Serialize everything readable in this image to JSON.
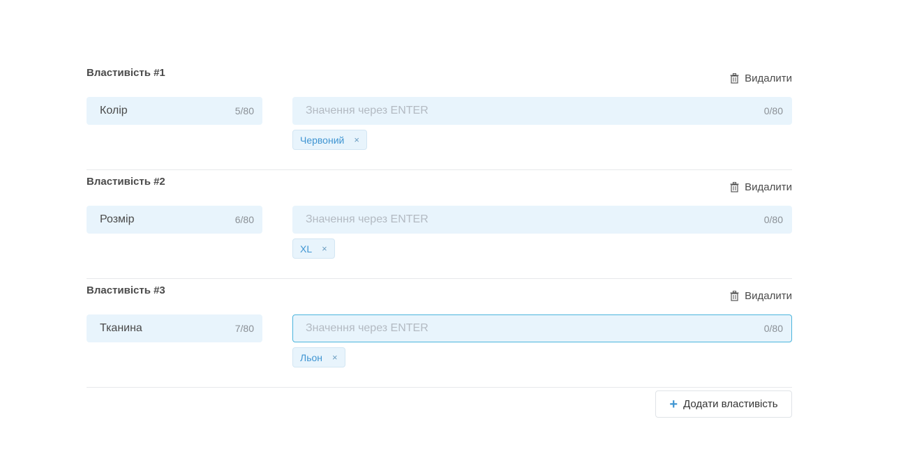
{
  "properties": [
    {
      "title": "Властивість #1",
      "delete_label": "Видалити",
      "name_value": "Колір",
      "name_counter": "5/80",
      "value_placeholder": "Значення через ENTER",
      "value_counter": "0/80",
      "tag": "Червоний"
    },
    {
      "title": "Властивість #2",
      "delete_label": "Видалити",
      "name_value": "Розмір",
      "name_counter": "6/80",
      "value_placeholder": "Значення через ENTER",
      "value_counter": "0/80",
      "tag": "XL"
    },
    {
      "title": "Властивість #3",
      "delete_label": "Видалити",
      "name_value": "Тканина",
      "name_counter": "7/80",
      "value_placeholder": "Значення через ENTER",
      "value_counter": "0/80",
      "tag": "Льон"
    }
  ],
  "tag_remove_glyph": "×",
  "add_button_label": "Додати властивість",
  "colors": {
    "accent": "#3f95d2",
    "field_bg": "#e8f4fc",
    "focus_border": "#4ab4dc"
  }
}
